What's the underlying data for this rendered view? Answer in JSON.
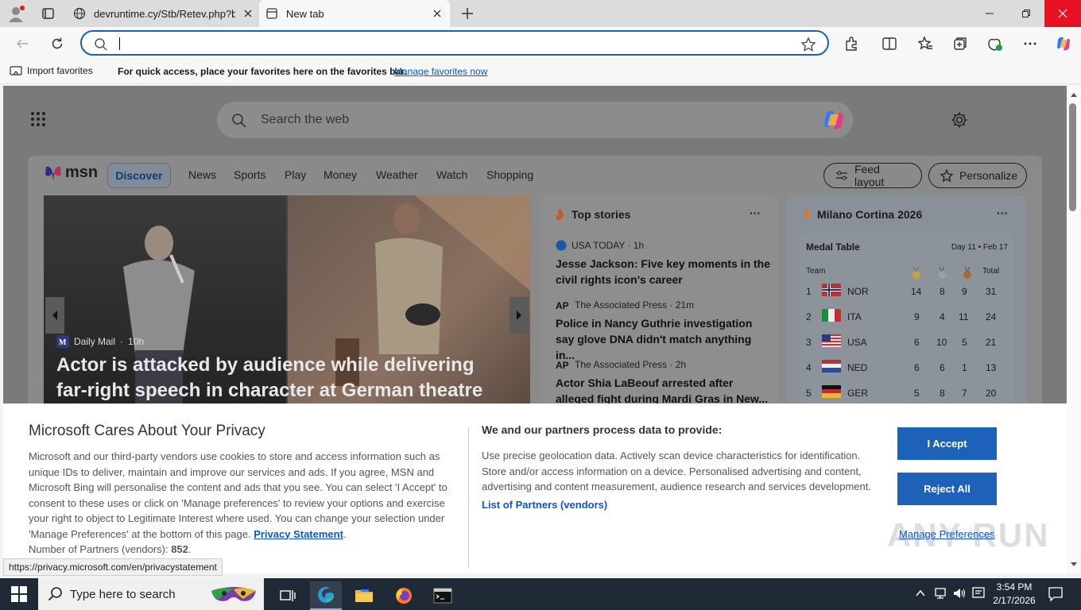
{
  "browser": {
    "tabs": [
      {
        "title": "devruntime.cy/Stb/Retev.php?bl="
      },
      {
        "title": "New tab"
      }
    ],
    "address_value": "",
    "favbar": {
      "import_label": "Import favorites",
      "message": "For quick access, place your favorites here on the favorites bar.",
      "manage_link": "Manage favorites now"
    }
  },
  "newtab": {
    "search_placeholder": "Search the web",
    "msn_brand": "msn",
    "nav": [
      "Discover",
      "News",
      "Sports",
      "Play",
      "Money",
      "Weather",
      "Watch",
      "Shopping"
    ],
    "feed_layout": "Feed layout",
    "personalize": "Personalize",
    "hero": {
      "source": "Daily Mail",
      "age": "10h",
      "headline": "Actor is attacked by audience while delivering far-right speech in character at German theatre"
    },
    "top_stories": {
      "title": "Top stories",
      "more": "···",
      "items": [
        {
          "source": "USA TODAY · 1h",
          "headline": "Jesse Jackson: Five key moments in the civil rights icon's career"
        },
        {
          "source": "The Associated Press · 21m",
          "headline": "Police in Nancy Guthrie investigation say glove DNA didn't match anything in..."
        },
        {
          "source": "The Associated Press · 2h",
          "headline": "Actor Shia LaBeouf arrested after alleged fight during Mardi Gras in New..."
        }
      ]
    },
    "olympics": {
      "title": "Milano Cortina 2026",
      "more": "···",
      "table_title": "Medal Table",
      "day": "Day 11 • Feb 17",
      "team_header": "Team",
      "total_header": "Total",
      "rows": [
        {
          "rank": "1",
          "team": "NOR",
          "gold": "14",
          "silver": "8",
          "bronze": "9",
          "total": "31"
        },
        {
          "rank": "2",
          "team": "ITA",
          "gold": "9",
          "silver": "4",
          "bronze": "11",
          "total": "24"
        },
        {
          "rank": "3",
          "team": "USA",
          "gold": "6",
          "silver": "10",
          "bronze": "5",
          "total": "21"
        },
        {
          "rank": "4",
          "team": "NED",
          "gold": "6",
          "silver": "6",
          "bronze": "1",
          "total": "13"
        },
        {
          "rank": "5",
          "team": "GER",
          "gold": "5",
          "silver": "8",
          "bronze": "7",
          "total": "20"
        }
      ]
    }
  },
  "privacy": {
    "title": "Microsoft Cares About Your Privacy",
    "body": "Microsoft and our third-party vendors use cookies to store and access information such as unique IDs to deliver, maintain and improve our services and ads. If you agree, MSN and Microsoft Bing will personalise the content and ads that you see. You can select 'I Accept' to consent to these uses or click on 'Manage preferences' to review your options and exercise your right to object to Legitimate Interest where used.  You can change your selection under 'Manage Preferences' at the bottom of this page.",
    "privacy_link": "Privacy Statement",
    "partners_count_label": "Number of Partners (vendors):",
    "partners_count": "852",
    "process_title": "We and our partners process data to provide:",
    "process_body": "Use precise geolocation data. Actively scan device characteristics for identification. Store and/or access information on a device. Personalised advertising and content, advertising and content measurement, audience research and services development.",
    "partners_link": "List of Partners (vendors)",
    "accept": "I Accept",
    "reject": "Reject All",
    "manage": "Manage Preferences",
    "watermark": "ANY RUN"
  },
  "status_url": "https://privacy.microsoft.com/en/privacystatement",
  "taskbar": {
    "search_placeholder": "Type here to search",
    "time": "3:54 PM",
    "date": "2/17/2026"
  },
  "colors": {
    "accent": "#1d62b8",
    "link": "#0b57c9",
    "taskbar": "#1f2a36"
  }
}
